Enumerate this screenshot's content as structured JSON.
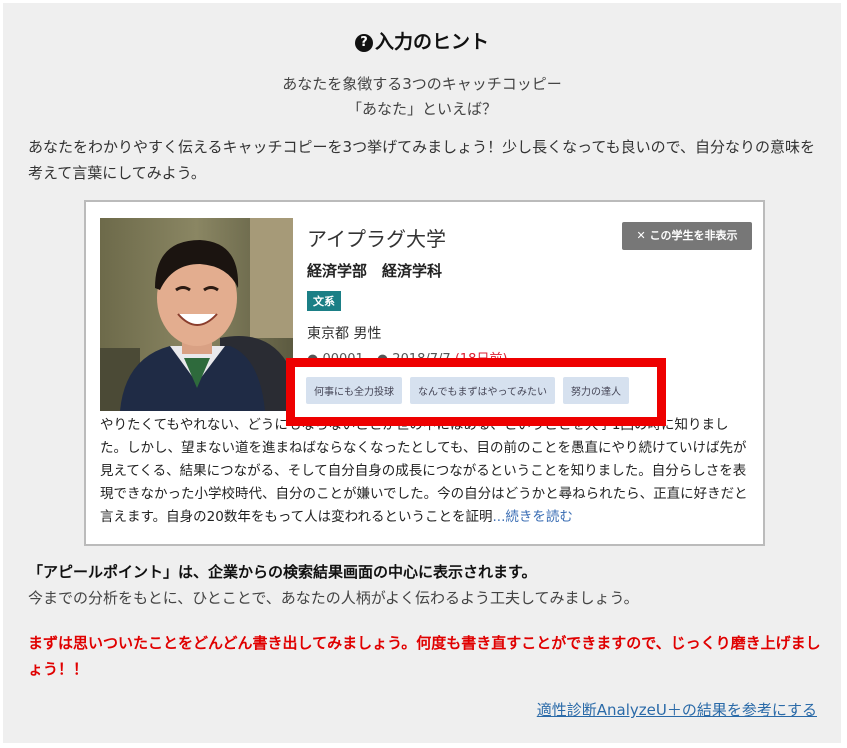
{
  "hint": {
    "icon": "question-circle-icon",
    "title": "入力のヒント",
    "subtitle1": "あなたを象徴する3つのキャッチコッピー",
    "subtitle2": "「あなた」といえば？",
    "lead": "あなたをわかりやすく伝えるキャッチコピーを3つ挙げてみましょう！少し長くなっても良いので、自分なりの意味を考えて言葉にしてみよう。"
  },
  "card": {
    "university": "アイプラグ大学",
    "faculty": "経済学部　経済学科",
    "field_tag": "文系",
    "location_gender": "東京都 男性",
    "meta_partial": "● 00001　● 2018/7/7",
    "meta_partial_red": "(18日前)",
    "hide_button": "この学生を非表示",
    "hide_button_icon": "close-x-icon",
    "catchphrases": [
      "何事にも全力投球",
      "なんでもまずはやってみたい",
      "努力の達人"
    ],
    "bio": "やりたくてもやれない、どうにもならないことが世の中にはある、ということを大学1回の時に知りました。しかし、望まない道を進まねばならなくなったとしても、目の前のことを愚直にやり続けていけば先が見えてくる、結果につながる、そして自分自身の成長につながるということを知りました。自分らしさを表現できなかった小学校時代、自分のことが嫌いでした。今の自分はどうかと尋ねられたら、正直に好きだと言えます。自身の20数年をもって人は変われるということを証明",
    "read_more": "...続きを読む",
    "highlight_color": "#ee0000"
  },
  "appeal": {
    "heading": "「アピールポイント」は、企業からの検索結果画面の中心に表示されます。",
    "description": "今までの分析をもとに、ひとことで、あなたの人柄がよく伝わるよう工夫してみましょう。"
  },
  "warning": "まずは思いついたことをどんどん書き出してみましょう。何度も書き直すことができますので、じっくり磨き上げましょう！！",
  "link": "適性診断AnalyzeU＋の結果を参考にする"
}
